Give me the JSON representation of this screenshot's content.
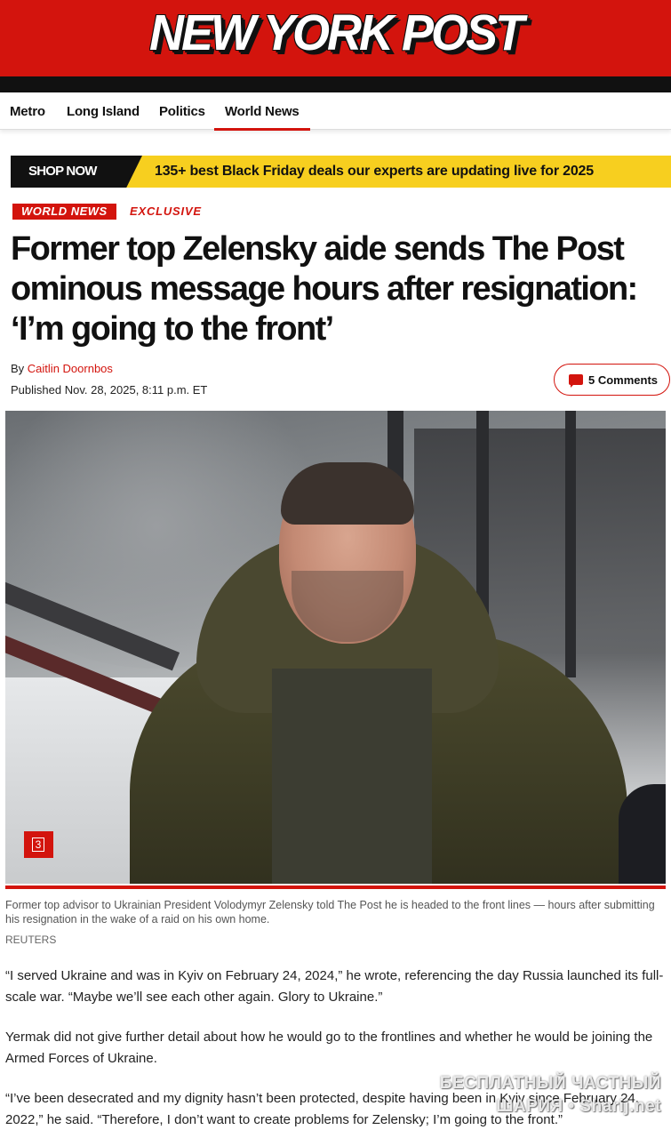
{
  "header": {
    "logo": "NEW YORK POST",
    "brand_color": "#d3140d"
  },
  "nav": {
    "items": [
      {
        "label": "Metro"
      },
      {
        "label": "Long Island"
      },
      {
        "label": "Politics"
      },
      {
        "label": "World News",
        "active": true
      }
    ]
  },
  "promo": {
    "shop_label": "SHOP NOW",
    "text": "135+ best Black Friday deals our experts are updating live for 2025",
    "bg_color": "#f7cf1f"
  },
  "article": {
    "section_tag": "WORLD NEWS",
    "label": "EXCLUSIVE",
    "headline": "Former top Zelensky aide sends The Post ominous message hours after resignation: ‘I’m going to the front’",
    "byline_prefix": "By ",
    "author": "Caitlin Doornbos",
    "published": "Published Nov. 28, 2025, 8:11 p.m. ET",
    "comments_label": "5 Comments",
    "gallery_count": "3",
    "caption": "Former top advisor to Ukrainian President Volodymyr Zelensky told The Post he is headed to the front lines — hours after submitting his resignation in the wake of a raid on his own home.",
    "credit": "REUTERS",
    "paragraphs": [
      "“I served Ukraine and was in Kyiv on February 24, 2024,” he wrote, referencing the day Russia launched its full-scale war. “Maybe we’ll see each other again. Glory to Ukraine.”",
      "Yermak did not give further detail about how he would go to the frontlines and whether he would be joining the Armed Forces of Ukraine.",
      "“I’ve been desecrated and my dignity hasn’t been protected, despite having been in Kyiv since February 24, 2022,” he said. “Therefore, I don’t want to create problems for Zelensky; I’m going to the front.”"
    ]
  },
  "watermark": {
    "line1": "БЕСПЛАТНЫЙ ЧАСТНЫЙ",
    "line2": "ШАРИЯ • Sharij.net"
  }
}
